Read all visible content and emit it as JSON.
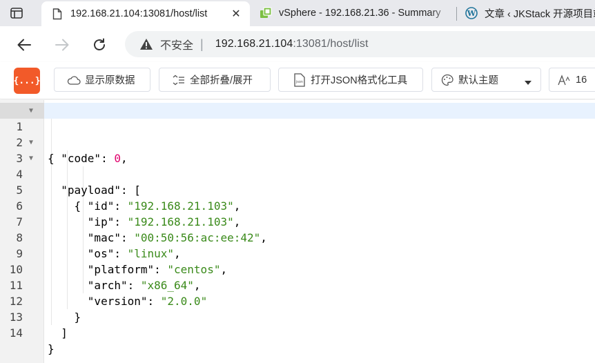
{
  "browser": {
    "tabs": [
      {
        "title": "192.168.21.104:13081/host/list",
        "icon": "page-icon",
        "active": true
      },
      {
        "title": "vSphere - 192.168.21.36 - Summary",
        "icon": "vsphere-icon",
        "active": false
      },
      {
        "title": "文章 ‹ JKStack 开源项目站",
        "icon": "wordpress-icon",
        "active": false
      }
    ],
    "address": {
      "security_label": "不安全",
      "host": "192.168.21.104",
      "rest": ":13081/host/list"
    }
  },
  "toolbar": {
    "logo": "{...}",
    "raw_label": "显示原数据",
    "fold_label": "全部折叠/展开",
    "formatter_label": "打开JSON格式化工具",
    "theme_label": "默认主题",
    "font_size": "16"
  },
  "editor": {
    "lines": [
      {
        "n": "1",
        "fold": true
      },
      {
        "n": "2",
        "fold": false
      },
      {
        "n": "3",
        "fold": true
      },
      {
        "n": "4",
        "fold": true
      },
      {
        "n": "5",
        "fold": false
      },
      {
        "n": "6",
        "fold": false
      },
      {
        "n": "7",
        "fold": false
      },
      {
        "n": "8",
        "fold": false
      },
      {
        "n": "9",
        "fold": false
      },
      {
        "n": "10",
        "fold": false
      },
      {
        "n": "11",
        "fold": false
      },
      {
        "n": "12",
        "fold": false
      },
      {
        "n": "13",
        "fold": false
      },
      {
        "n": "14",
        "fold": false
      }
    ],
    "json": {
      "code_key": "\"code\"",
      "code_value": "0",
      "payload_key": "\"payload\"",
      "id_key": "\"id\"",
      "id_value": "\"192.168.21.103\"",
      "ip_key": "\"ip\"",
      "ip_value": "\"192.168.21.103\"",
      "mac_key": "\"mac\"",
      "mac_value": "\"00:50:56:ac:ee:42\"",
      "os_key": "\"os\"",
      "os_value": "\"linux\"",
      "platform_key": "\"platform\"",
      "platform_value": "\"centos\"",
      "arch_key": "\"arch\"",
      "arch_value": "\"x86_64\"",
      "version_key": "\"version\"",
      "version_value": "\"2.0.0\""
    }
  },
  "colors": {
    "logo_bg": "#f25a29",
    "string": "#3a8a1a",
    "number": "#e1006c",
    "active_line": "#e8f2fe"
  }
}
